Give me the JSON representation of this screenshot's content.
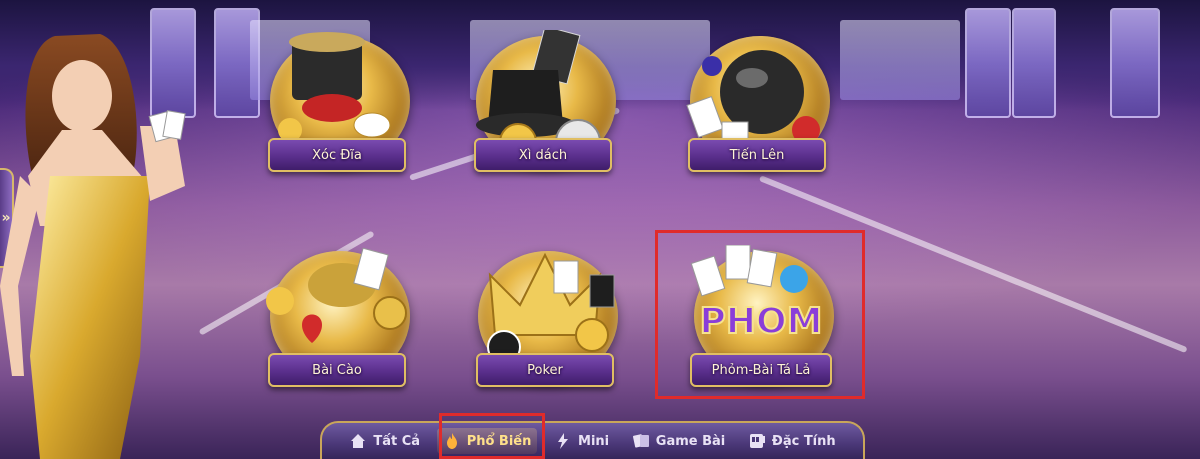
{
  "side_handle": {
    "glyph": "»"
  },
  "games": [
    {
      "id": "xoc-dia",
      "label": "Xóc Đĩa"
    },
    {
      "id": "xi-dach",
      "label": "Xì dách"
    },
    {
      "id": "tien-len",
      "label": "Tiến Lên"
    },
    {
      "id": "bai-cao",
      "label": "Bài Cào"
    },
    {
      "id": "poker",
      "label": "Poker"
    },
    {
      "id": "phom",
      "label": "Phỏm-Bài Tá Lả",
      "logo_text": "PHOM"
    }
  ],
  "tabs": [
    {
      "label": "Tất Cả",
      "icon": "home-icon"
    },
    {
      "label": "Phổ Biến",
      "icon": "fire-icon",
      "active": true
    },
    {
      "label": "Mini",
      "icon": "lightning-icon"
    },
    {
      "label": "Game Bài",
      "icon": "cards-icon"
    },
    {
      "label": "Đặc Tính",
      "icon": "slot-machine-icon"
    }
  ],
  "colors": {
    "highlight": "#e02b2b",
    "ribbon": "#5a2f8c",
    "gold": "#e0be63",
    "active_tab": "#ffe08a"
  }
}
